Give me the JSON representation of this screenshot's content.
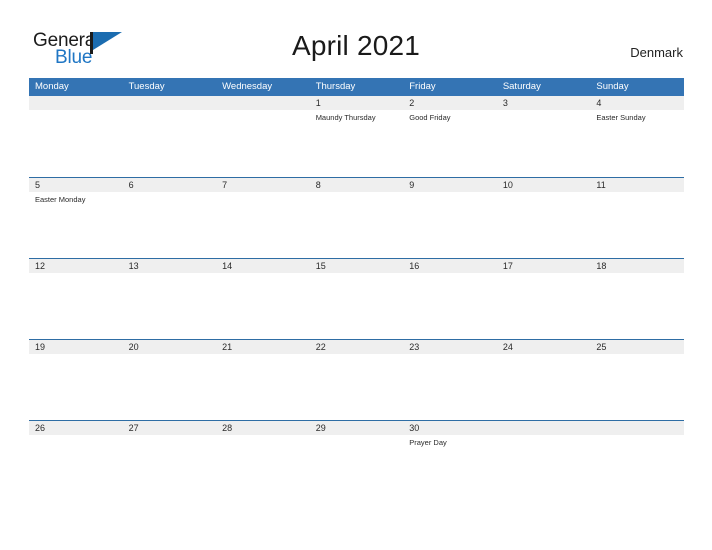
{
  "brand": {
    "word_one": "General",
    "word_two": "Blue",
    "flag_icon": "general-blue-flag-icon",
    "accent_color": "#1b6cb0"
  },
  "header": {
    "title": "April 2021",
    "locale": "Denmark"
  },
  "theme": {
    "header_blue": "#3474b4",
    "row_line_blue": "#2e6da4",
    "number_band_gray": "#efefef",
    "text_dark": "#222222"
  },
  "calendar": {
    "month": "April",
    "year": "2021",
    "country": "Denmark",
    "weekday_headers": [
      "Monday",
      "Tuesday",
      "Wednesday",
      "Thursday",
      "Friday",
      "Saturday",
      "Sunday"
    ],
    "weeks": [
      {
        "days": [
          {
            "num": "",
            "event": ""
          },
          {
            "num": "",
            "event": ""
          },
          {
            "num": "",
            "event": ""
          },
          {
            "num": "1",
            "event": "Maundy Thursday"
          },
          {
            "num": "2",
            "event": "Good Friday"
          },
          {
            "num": "3",
            "event": ""
          },
          {
            "num": "4",
            "event": "Easter Sunday"
          }
        ]
      },
      {
        "days": [
          {
            "num": "5",
            "event": "Easter Monday"
          },
          {
            "num": "6",
            "event": ""
          },
          {
            "num": "7",
            "event": ""
          },
          {
            "num": "8",
            "event": ""
          },
          {
            "num": "9",
            "event": ""
          },
          {
            "num": "10",
            "event": ""
          },
          {
            "num": "11",
            "event": ""
          }
        ]
      },
      {
        "days": [
          {
            "num": "12",
            "event": ""
          },
          {
            "num": "13",
            "event": ""
          },
          {
            "num": "14",
            "event": ""
          },
          {
            "num": "15",
            "event": ""
          },
          {
            "num": "16",
            "event": ""
          },
          {
            "num": "17",
            "event": ""
          },
          {
            "num": "18",
            "event": ""
          }
        ]
      },
      {
        "days": [
          {
            "num": "19",
            "event": ""
          },
          {
            "num": "20",
            "event": ""
          },
          {
            "num": "21",
            "event": ""
          },
          {
            "num": "22",
            "event": ""
          },
          {
            "num": "23",
            "event": ""
          },
          {
            "num": "24",
            "event": ""
          },
          {
            "num": "25",
            "event": ""
          }
        ]
      },
      {
        "days": [
          {
            "num": "26",
            "event": ""
          },
          {
            "num": "27",
            "event": ""
          },
          {
            "num": "28",
            "event": ""
          },
          {
            "num": "29",
            "event": ""
          },
          {
            "num": "30",
            "event": "Prayer Day"
          },
          {
            "num": "",
            "event": ""
          },
          {
            "num": "",
            "event": ""
          }
        ]
      }
    ]
  }
}
